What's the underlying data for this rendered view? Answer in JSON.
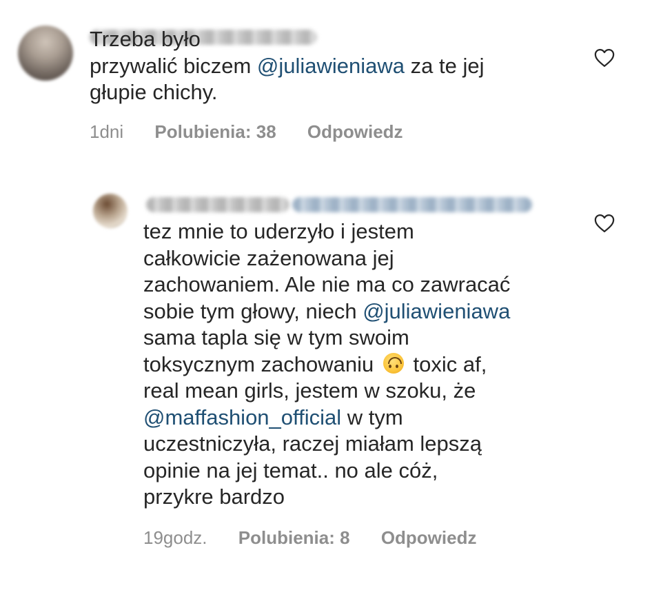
{
  "comments": [
    {
      "avatar_icon": "avatar-blurred",
      "username": "",
      "text_runs": [
        {
          "t": "Trzeba było\nprzywalić biczem ",
          "type": "text"
        },
        {
          "t": "@juliawieniawa",
          "type": "mention"
        },
        {
          "t": " za te jej\ngłupie chichy.",
          "type": "text"
        }
      ],
      "time": "1dni",
      "likes": "Polubienia: 38",
      "reply": "Odpowiedz",
      "like_icon": "heart-outline-icon"
    },
    {
      "avatar_icon": "avatar-blurred",
      "username": "",
      "reply_to": "",
      "text_runs": [
        {
          "t": "tez mnie to uderzyło i jestem\ncałkowicie zażenowana jej\nzachowaniem. Ale nie ma co zawracać\nsobie tym głowy, niech ",
          "type": "text"
        },
        {
          "t": "@juliawieniawa",
          "type": "mention"
        },
        {
          "t": "\nsama tapla się w tym swoim\ntoksycznym zachowaniu ",
          "type": "text"
        },
        {
          "t": "🙃",
          "type": "emoji"
        },
        {
          "t": " toxic af,\nreal mean girls, jestem w szoku, że\n",
          "type": "text"
        },
        {
          "t": "@maffashion_official",
          "type": "mention"
        },
        {
          "t": " w tym\nuczestniczyła, raczej miałam lepszą\nopinie na jej temat.. no ale cóż,\nprzykre bardzo",
          "type": "text"
        }
      ],
      "time": "19godz.",
      "likes": "Polubienia: 8",
      "reply": "Odpowiedz",
      "like_icon": "heart-outline-icon"
    }
  ],
  "colors": {
    "text": "#262626",
    "mention": "#1f4f73",
    "meta": "#8e8e8e",
    "background": "#ffffff"
  }
}
